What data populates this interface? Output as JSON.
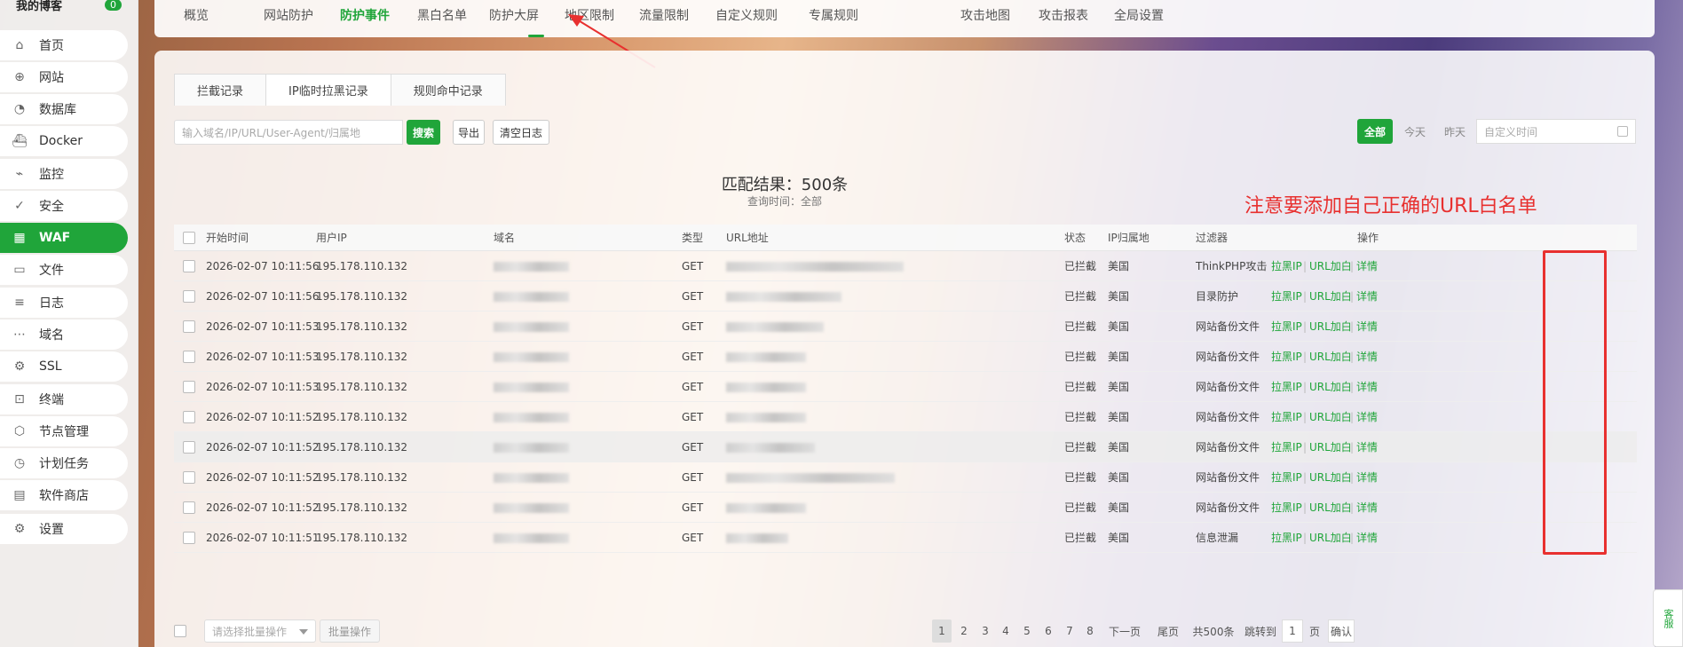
{
  "sidebar": {
    "title": "我的博客",
    "badge": "0",
    "items": [
      {
        "label": "首页",
        "icon": "home-icon"
      },
      {
        "label": "网站",
        "icon": "globe-icon"
      },
      {
        "label": "数据库",
        "icon": "database-icon"
      },
      {
        "label": "Docker",
        "icon": "docker-icon"
      },
      {
        "label": "监控",
        "icon": "monitor-icon"
      },
      {
        "label": "安全",
        "icon": "shield-icon"
      },
      {
        "label": "WAF",
        "icon": "waf-icon"
      },
      {
        "label": "文件",
        "icon": "folder-icon"
      },
      {
        "label": "日志",
        "icon": "log-icon"
      },
      {
        "label": "域名",
        "icon": "domain-icon"
      },
      {
        "label": "SSL",
        "icon": "ssl-icon"
      },
      {
        "label": "终端",
        "icon": "terminal-icon"
      },
      {
        "label": "节点管理",
        "icon": "node-icon"
      },
      {
        "label": "计划任务",
        "icon": "clock-icon"
      },
      {
        "label": "软件商店",
        "icon": "store-icon"
      },
      {
        "label": "设置",
        "icon": "gear-icon"
      }
    ],
    "active_index": 6
  },
  "topnav": {
    "tabs": [
      "概览",
      "网站防护",
      "防护事件",
      "黑白名单",
      "防护大屏",
      "地区限制",
      "流量限制",
      "自定义规则",
      "专属规则",
      "攻击地图",
      "攻击报表",
      "全局设置"
    ],
    "active": "防护事件"
  },
  "subtabs": [
    "拦截记录",
    "IP临时拉黑记录",
    "规则命中记录"
  ],
  "toolbar": {
    "search_placeholder": "输入域名/IP/URL/User-Agent/归属地",
    "search_label": "搜索",
    "export_label": "导出",
    "clear_label": "清空日志",
    "time_all": "全部",
    "time_today": "今天",
    "time_yesterday": "昨天",
    "time_custom_placeholder": "自定义时间"
  },
  "summary": {
    "match": "匹配结果：500条",
    "query_time": "查询时间：全部"
  },
  "annotation": "注意要添加自己正确的URL白名单",
  "table": {
    "headers": [
      "开始时间",
      "用户IP",
      "域名",
      "类型",
      "URL地址",
      "状态",
      "IP归属地",
      "过滤器",
      "操作"
    ],
    "rows": [
      {
        "time": "2026-02-07 10:11:56",
        "ip": "195.178.110.132",
        "type": "GET",
        "status": "已拦截",
        "geo": "美国",
        "filter": "ThinkPHP攻击"
      },
      {
        "time": "2026-02-07 10:11:56",
        "ip": "195.178.110.132",
        "type": "GET",
        "status": "已拦截",
        "geo": "美国",
        "filter": "目录防护"
      },
      {
        "time": "2026-02-07 10:11:53",
        "ip": "195.178.110.132",
        "type": "GET",
        "status": "已拦截",
        "geo": "美国",
        "filter": "网站备份文件"
      },
      {
        "time": "2026-02-07 10:11:53",
        "ip": "195.178.110.132",
        "type": "GET",
        "status": "已拦截",
        "geo": "美国",
        "filter": "网站备份文件"
      },
      {
        "time": "2026-02-07 10:11:53",
        "ip": "195.178.110.132",
        "type": "GET",
        "status": "已拦截",
        "geo": "美国",
        "filter": "网站备份文件"
      },
      {
        "time": "2026-02-07 10:11:52",
        "ip": "195.178.110.132",
        "type": "GET",
        "status": "已拦截",
        "geo": "美国",
        "filter": "网站备份文件"
      },
      {
        "time": "2026-02-07 10:11:52",
        "ip": "195.178.110.132",
        "type": "GET",
        "status": "已拦截",
        "geo": "美国",
        "filter": "网站备份文件"
      },
      {
        "time": "2026-02-07 10:11:52",
        "ip": "195.178.110.132",
        "type": "GET",
        "status": "已拦截",
        "geo": "美国",
        "filter": "网站备份文件"
      },
      {
        "time": "2026-02-07 10:11:52",
        "ip": "195.178.110.132",
        "type": "GET",
        "status": "已拦截",
        "geo": "美国",
        "filter": "网站备份文件"
      },
      {
        "time": "2026-02-07 10:11:51",
        "ip": "195.178.110.132",
        "type": "GET",
        "status": "已拦截",
        "geo": "美国",
        "filter": "信息泄漏"
      }
    ],
    "actions": {
      "blacklist": "拉黑IP",
      "url_whitelist": "URL加白",
      "detail": "详情",
      "sep": "|"
    }
  },
  "footer": {
    "batch_placeholder": "请选择批量操作",
    "batch_button": "批量操作",
    "pages": [
      "1",
      "2",
      "3",
      "4",
      "5",
      "6",
      "7",
      "8"
    ],
    "next": "下一页",
    "last": "尾页",
    "total": "共500条",
    "jump_label": "跳转到",
    "jump_value": "1",
    "page_unit": "页",
    "confirm": "确认"
  },
  "side_widget": "客服",
  "colors": {
    "accent": "#20a53a",
    "annotation": "#e8302f"
  }
}
